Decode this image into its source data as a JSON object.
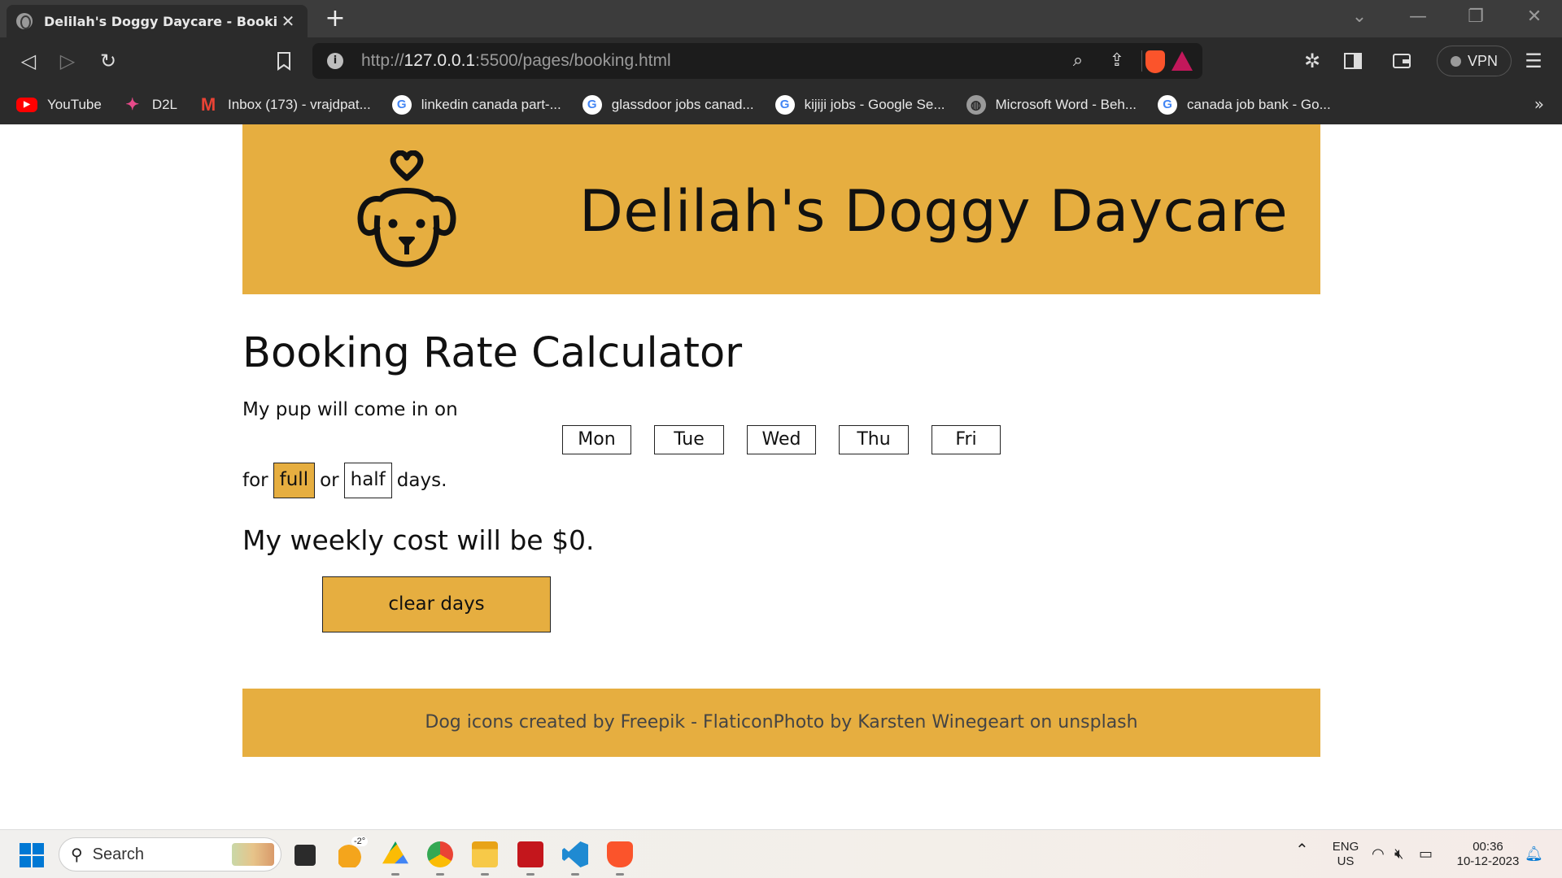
{
  "browser": {
    "tab_title": "Delilah's Doggy Daycare - Booking Rate Calculator",
    "tab_close": "✕",
    "new_tab": "+",
    "url_prefix": "http://",
    "url_host": "127.0.0.1",
    "url_rest": ":5500/pages/booking.html",
    "vpn_label": "VPN",
    "bookmarks": [
      {
        "label": "YouTube",
        "icon": "youtube-icon"
      },
      {
        "label": "D2L",
        "icon": "d2l-icon"
      },
      {
        "label": "Inbox (173) - vrajdpat...",
        "icon": "gmail-icon"
      },
      {
        "label": "linkedin canada part-...",
        "icon": "google-icon"
      },
      {
        "label": "glassdoor jobs canad...",
        "icon": "google-icon"
      },
      {
        "label": "kijiji jobs - Google Se...",
        "icon": "google-icon"
      },
      {
        "label": "Microsoft Word - Beh...",
        "icon": "globe-icon"
      },
      {
        "label": "canada job bank - Go...",
        "icon": "google-icon"
      }
    ],
    "bookmarks_more": "»"
  },
  "site": {
    "title": "Delilah's Doggy Daycare",
    "calculator_title": "Booking Rate Calculator",
    "pup_text": "My pup will come in on",
    "days": [
      "Mon",
      "Tue",
      "Wed",
      "Thu",
      "Fri"
    ],
    "for_text": "for",
    "full_label": "full",
    "or_text": "or",
    "half_label": "half",
    "days_text": "days.",
    "cost_text": "My weekly cost will be $0.",
    "clear_button": "clear days",
    "footer": "Dog icons created by Freepik - FlaticonPhoto by Karsten Winegeart on unsplash",
    "accent_color": "#e6ae40",
    "selected_duration": "full"
  },
  "taskbar": {
    "search_placeholder": "Search",
    "weather": "-2°",
    "lang_top": "ENG",
    "lang_bottom": "US",
    "time": "00:36",
    "date": "10-12-2023"
  }
}
